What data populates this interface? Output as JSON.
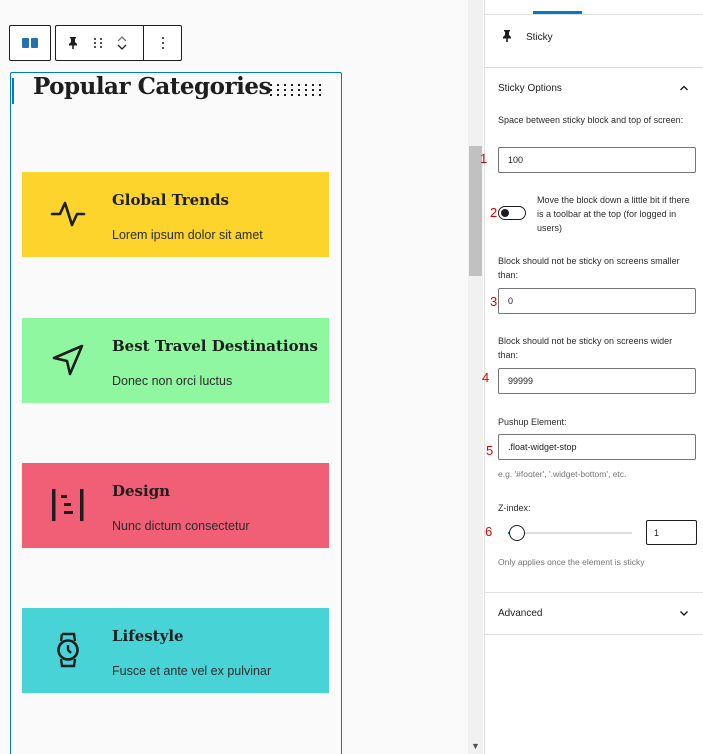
{
  "editor": {
    "heading": "Popular Categories",
    "cards": [
      {
        "title": "Global Trends",
        "desc": "Lorem ipsum dolor sit amet",
        "color": "#fcd42c",
        "icon": "activity-icon"
      },
      {
        "title": "Best Travel Destinations",
        "desc": "Donec non orci luctus",
        "color": "#8ef79f",
        "icon": "navigation-icon"
      },
      {
        "title": "Design",
        "desc": "Nunc dictum consectetur",
        "color": "#f05f75",
        "icon": "design-icon"
      },
      {
        "title": "Lifestyle",
        "desc": "Fusce et ante vel ex pulvinar",
        "color": "#48d3d7",
        "icon": "watch-icon"
      }
    ]
  },
  "panel": {
    "sticky_title": "Sticky",
    "options_title": "Sticky Options",
    "space_label": "Space between sticky block and top of screen:",
    "space_value": "100",
    "toggle_label": "Move the block down a little bit if there is a toolbar at the top (for logged in users)",
    "toggle_on": false,
    "smaller_label": "Block should not be sticky on screens smaller than:",
    "smaller_value": "0",
    "wider_label": "Block should not be sticky on screens wider than:",
    "wider_value": "99999",
    "pushup_label": "Pushup Element:",
    "pushup_value": ".float-widget-stop",
    "pushup_help": "e.g. '#footer', '.widget-bottom', etc.",
    "zindex_label": "Z-index:",
    "zindex_value": "1",
    "zindex_help": "Only applies once the element is sticky",
    "advanced_title": "Advanced"
  },
  "markers": [
    "1",
    "2",
    "3",
    "4",
    "5",
    "6"
  ],
  "colors": {
    "accent": "#007cba",
    "marker": "#e00000"
  }
}
